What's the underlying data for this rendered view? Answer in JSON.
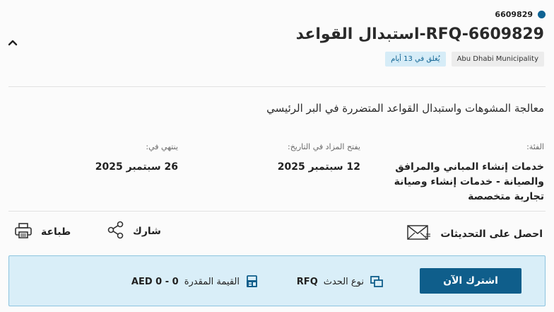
{
  "header": {
    "reference": "6609829",
    "title": "RFQ-6609829-استبدال القواعد",
    "badges": {
      "organization": "Abu Dhabi Municipality",
      "closes_in": "يُغلق في 13 أيام"
    },
    "status_color": "#0f6393"
  },
  "description": "معالجة المشوهات واستبدال القواعد المتضررة في البر الرئيسي",
  "info": {
    "category": {
      "label": "الفئة:",
      "value": "خدمات إنشاء المباني والمرافق والصيانة - خدمات إنشاء وصيانة تجارية متخصصة"
    },
    "opens": {
      "label": "يفتح المزاد في التاريخ:",
      "value": "12 سبتمبر 2025"
    },
    "ends": {
      "label": "ينتهي في:",
      "value": "26 سبتمبر 2025"
    }
  },
  "actions": {
    "updates": {
      "label": "احصل على التحديثات",
      "icon": "envelope-icon"
    },
    "share": {
      "label": "شارك",
      "icon": "share-icon"
    },
    "print": {
      "label": "طباعة",
      "icon": "printer-icon"
    }
  },
  "subscribe": {
    "button_label": "اشترك الآن",
    "event_type_label": "نوع الحدث",
    "event_type_value": "RFQ",
    "estimated_value_label": "القيمة المقدرة",
    "estimated_value": "AED 0 - 0",
    "accent_color": "#0f5e8b"
  }
}
